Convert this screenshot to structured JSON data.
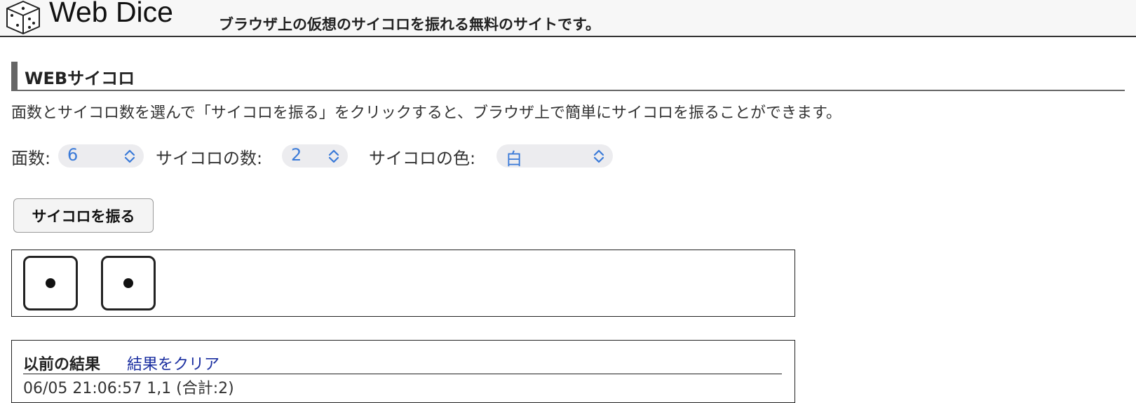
{
  "header": {
    "logo_icon": "dice-icon",
    "title": "Web Dice",
    "tagline": "ブラウザ上の仮想のサイコロを振れる無料のサイトです。"
  },
  "section": {
    "title": "WEBサイコロ",
    "description": "面数とサイコロ数を選んで「サイコロを振る」をクリックすると、ブラウザ上で簡単にサイコロを振ることができます。"
  },
  "controls": {
    "faces_label": "面数:",
    "faces_value": "6",
    "count_label": "サイコロの数:",
    "count_value": "2",
    "color_label": "サイコロの色:",
    "color_value": "白"
  },
  "roll_button": "サイコロを振る",
  "dice": [
    {
      "value": 1
    },
    {
      "value": 1
    }
  ],
  "history": {
    "title": "以前の結果",
    "clear_link": "結果をクリア",
    "entries": [
      "06/05 21:06:57  1,1  (合計:2)"
    ]
  },
  "colors": {
    "select_text": "#3a7ad8",
    "link": "#1a2ea0",
    "section_bar": "#666666"
  }
}
